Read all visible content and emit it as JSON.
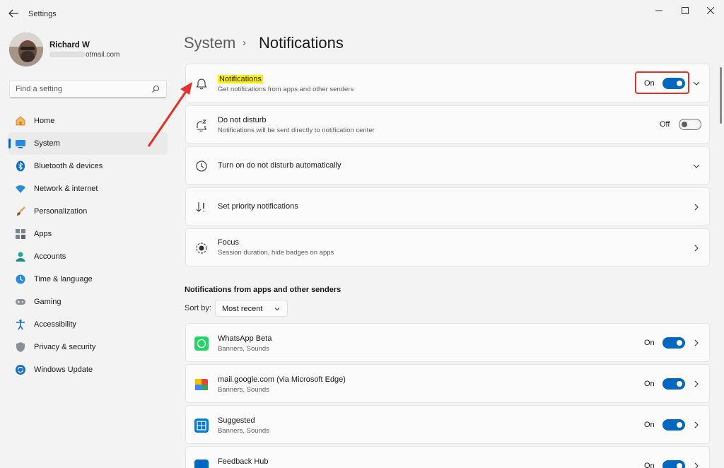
{
  "window": {
    "title": "Settings",
    "back_icon": "back-arrow-icon"
  },
  "profile": {
    "name": "Richard W",
    "email_visible": "otmail.com"
  },
  "search": {
    "placeholder": "Find a setting",
    "icon": "search-icon"
  },
  "nav": {
    "items": [
      {
        "label": "Home",
        "icon": "home-icon",
        "active": false
      },
      {
        "label": "System",
        "icon": "system-icon",
        "active": true
      },
      {
        "label": "Bluetooth & devices",
        "icon": "bluetooth-icon",
        "active": false
      },
      {
        "label": "Network & internet",
        "icon": "wifi-icon",
        "active": false
      },
      {
        "label": "Personalization",
        "icon": "brush-icon",
        "active": false
      },
      {
        "label": "Apps",
        "icon": "apps-icon",
        "active": false
      },
      {
        "label": "Accounts",
        "icon": "person-icon",
        "active": false
      },
      {
        "label": "Time & language",
        "icon": "clock-globe-icon",
        "active": false
      },
      {
        "label": "Gaming",
        "icon": "gamepad-icon",
        "active": false
      },
      {
        "label": "Accessibility",
        "icon": "accessibility-icon",
        "active": false
      },
      {
        "label": "Privacy & security",
        "icon": "shield-icon",
        "active": false
      },
      {
        "label": "Windows Update",
        "icon": "update-icon",
        "active": false
      }
    ]
  },
  "breadcrumb": {
    "parent": "System",
    "separator": "›",
    "current": "Notifications"
  },
  "settings": {
    "notifications": {
      "title": "Notifications",
      "subtitle": "Get notifications from apps and other senders",
      "state": "On"
    },
    "dnd": {
      "title": "Do not disturb",
      "subtitle": "Notifications will be sent directly to notification center",
      "state": "Off"
    },
    "dnd_auto": {
      "title": "Turn on do not disturb automatically"
    },
    "priority": {
      "title": "Set priority notifications"
    },
    "focus": {
      "title": "Focus",
      "subtitle": "Session duration, hide badges on apps"
    }
  },
  "apps_section": {
    "title": "Notifications from apps and other senders",
    "sort_label": "Sort by:",
    "sort_value": "Most recent",
    "apps": [
      {
        "name": "WhatsApp Beta",
        "detail": "Banners, Sounds",
        "state": "On",
        "color": "#25d366"
      },
      {
        "name": "mail.google.com (via Microsoft Edge)",
        "detail": "Banners, Sounds",
        "state": "On",
        "color": "#ea4335"
      },
      {
        "name": "Suggested",
        "detail": "Banners, Sounds",
        "state": "On",
        "color": "#0078d4"
      },
      {
        "name": "Feedback Hub",
        "detail": "",
        "state": "On",
        "color": "#0067c0"
      }
    ]
  },
  "colors": {
    "accent": "#0067c0",
    "annotation": "#e0312b",
    "highlight": "#fff200"
  }
}
